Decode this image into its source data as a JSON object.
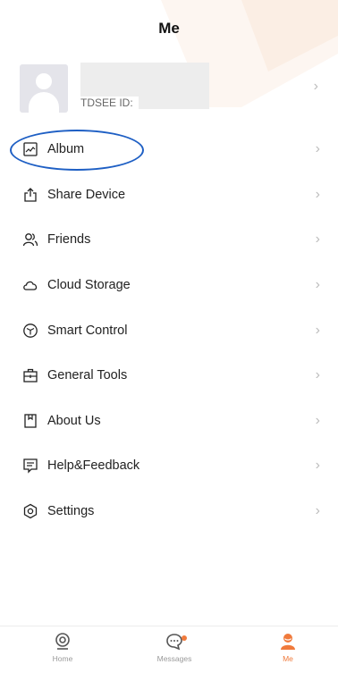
{
  "header": {
    "title": "Me"
  },
  "profile": {
    "id_label": "TDSEE ID:"
  },
  "menu": {
    "items": [
      {
        "label": "Album",
        "icon": "image-icon"
      },
      {
        "label": "Share Device",
        "icon": "share-icon"
      },
      {
        "label": "Friends",
        "icon": "friends-icon"
      },
      {
        "label": "Cloud Storage",
        "icon": "cloud-icon"
      },
      {
        "label": "Smart Control",
        "icon": "cube-icon"
      },
      {
        "label": "General Tools",
        "icon": "toolbox-icon"
      },
      {
        "label": "About Us",
        "icon": "bookmark-icon"
      },
      {
        "label": "Help&Feedback",
        "icon": "feedback-icon"
      },
      {
        "label": "Settings",
        "icon": "settings-icon"
      }
    ]
  },
  "tabbar": {
    "home": "Home",
    "messages": "Messages",
    "me": "Me"
  },
  "colors": {
    "accent": "#f07a3c",
    "highlight_ring": "#1e5fc4"
  }
}
